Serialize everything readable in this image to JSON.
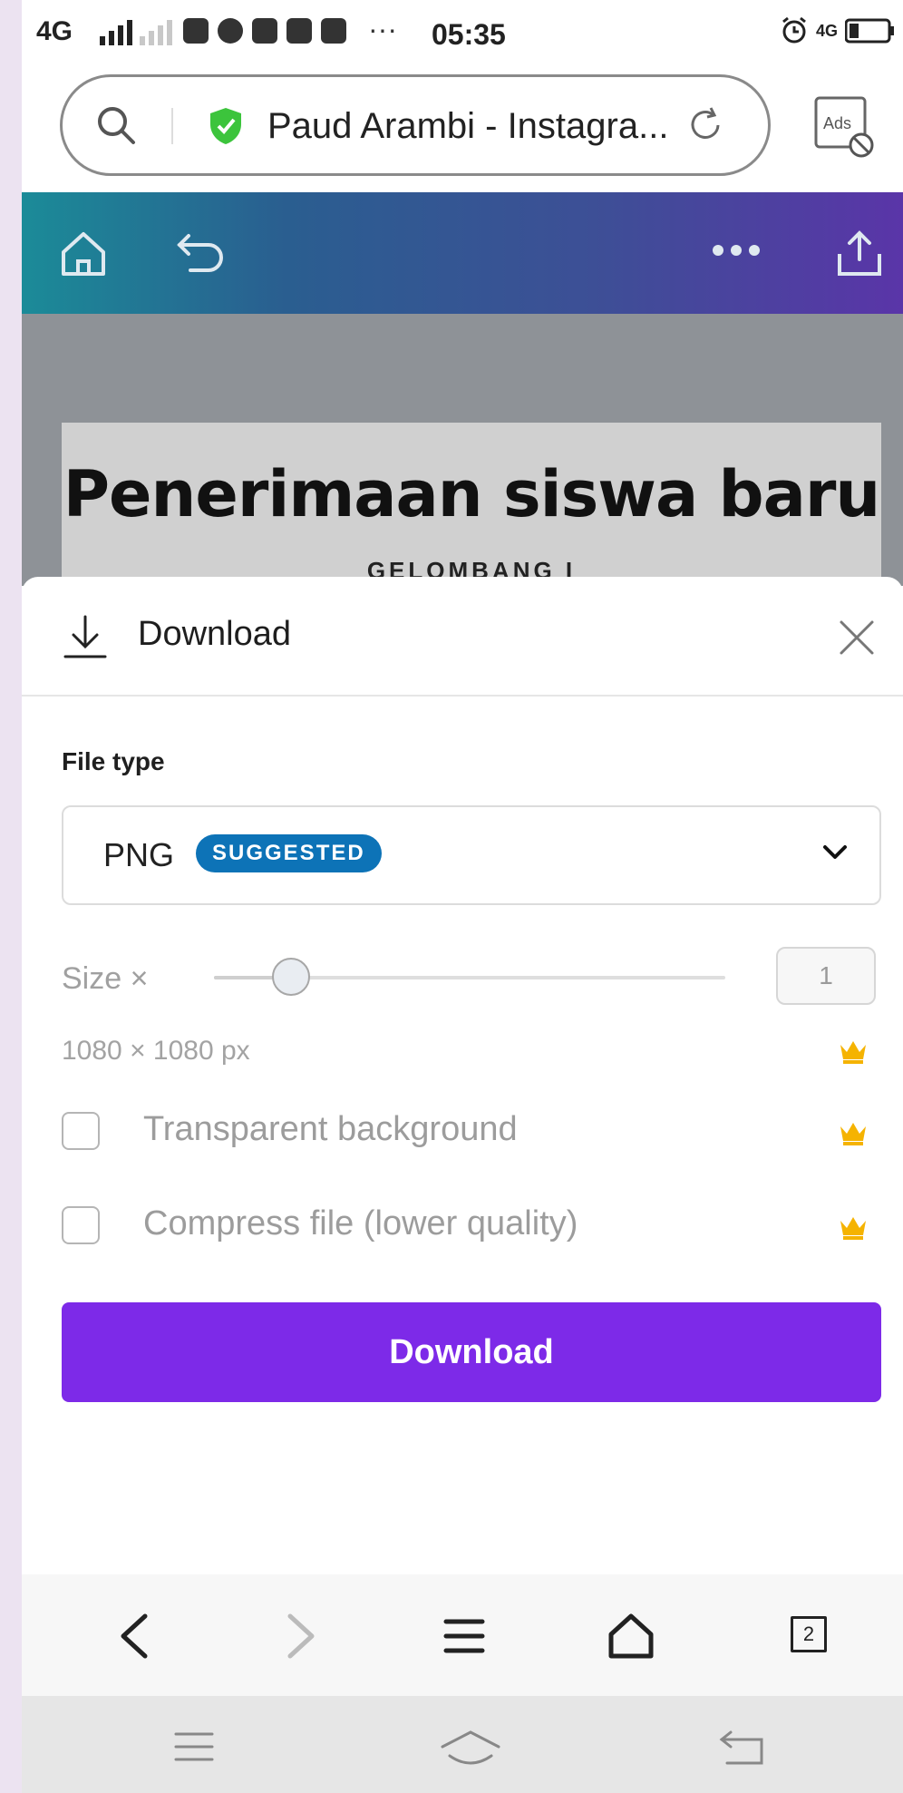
{
  "status_bar": {
    "network": "4G",
    "time": "05:35",
    "more": "···",
    "right_network": "4G"
  },
  "url_bar": {
    "page_title": "Paud Arambi - Instagra...",
    "ads_label": "Ads"
  },
  "canvas": {
    "headline": "Penerimaan siswa baru",
    "subheadline": "GELOMBANG I"
  },
  "download_panel": {
    "title": "Download",
    "file_type_label": "File type",
    "file_type_value": "PNG",
    "file_type_badge": "SUGGESTED",
    "size_label": "Size ×",
    "size_value": "1",
    "size_slider_fraction": 0.15,
    "dimensions": "1080 × 1080 px",
    "transparent_background_label": "Transparent background",
    "compress_file_label": "Compress file (lower quality)",
    "download_button_label": "Download",
    "premium_icon": "crown-icon",
    "premium_color": "#f5b301",
    "accent_color": "#7d2ae8",
    "badge_color": "#0d73b7"
  },
  "browser_nav": {
    "tab_count": "2"
  }
}
